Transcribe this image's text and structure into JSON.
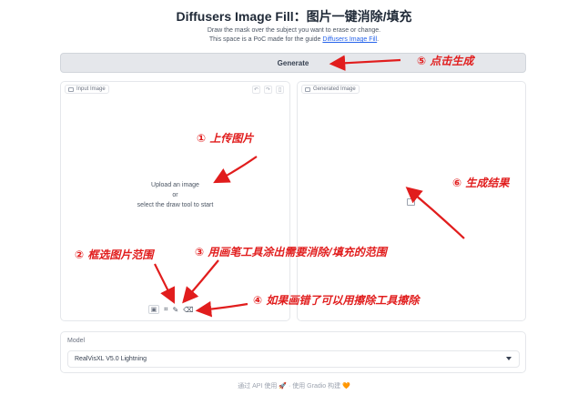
{
  "header": {
    "title": "Diffusers Image Fill：图片一键消除/填充",
    "desc_line1": "Draw the mask over the subject you want to erase or change.",
    "desc_line2_prefix": "This space is a PoC made for the guide ",
    "desc_line2_link": "Diffusers Image Fill",
    "desc_line2_suffix": "."
  },
  "toolbar": {
    "generate_label": "Generate"
  },
  "input_panel": {
    "label": "Input Image",
    "upload_line1": "Upload an image",
    "upload_line2": "or",
    "upload_line3": "select the draw tool to start",
    "top_tool_icons": [
      "undo-icon",
      "redo-icon",
      "trash-icon"
    ],
    "bottom_tool_icons": [
      "image-icon",
      "crop-icon",
      "brush-icon",
      "eraser-icon"
    ]
  },
  "output_panel": {
    "label": "Generated Image",
    "placeholder_icon": "image-icon"
  },
  "model": {
    "label": "Model",
    "selected": "RealVisXL V5.0 Lightning"
  },
  "footer": {
    "text": "通过 API 使用 🚀 · 使用 Gradio 构建 🧡"
  },
  "annotations": {
    "a1": "① 上传图片",
    "a2": "② 框选图片范围",
    "a3": "③ 用画笔工具涂出需要消除/填充的范围",
    "a4": "④ 如果画错了可以用擦除工具擦除",
    "a5": "⑤ 点击生成",
    "a6": "⑥ 生成结果"
  },
  "colors": {
    "annotation": "#e11d1d",
    "link": "#2563eb"
  }
}
